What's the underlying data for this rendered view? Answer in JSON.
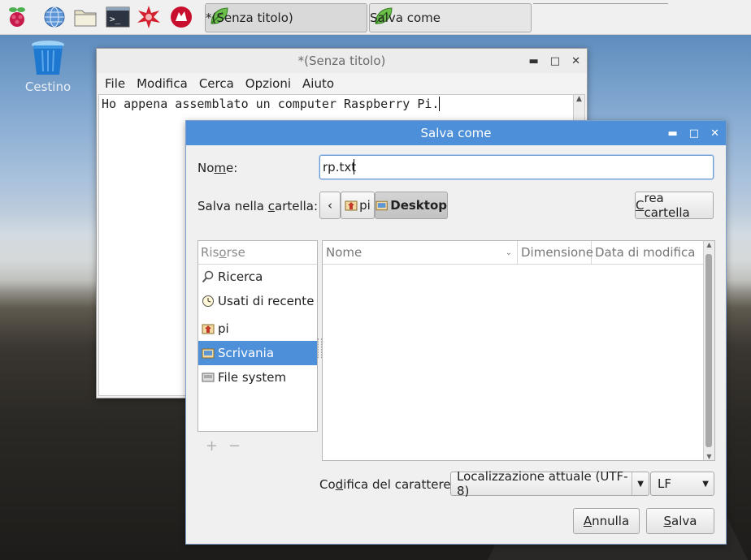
{
  "taskbar": {
    "tasks": [
      {
        "label": "*(Senza titolo)"
      },
      {
        "label": "Salva come"
      }
    ]
  },
  "desktop": {
    "trash_label": "Cestino"
  },
  "leafpad": {
    "title": "*(Senza titolo)",
    "menu": [
      "File",
      "Modifica",
      "Cerca",
      "Opzioni",
      "Aiuto"
    ],
    "text": "Ho appena assemblato un computer Raspberry Pi."
  },
  "save_dialog": {
    "title": "Salva come",
    "name_label_pre": "No",
    "name_label_u": "m",
    "name_label_post": "e:",
    "name_value": "rp.txt",
    "folder_label_pre": "Salva nella ",
    "folder_label_u": "c",
    "folder_label_post": "artella:",
    "path": [
      "pi",
      "Desktop"
    ],
    "create_folder_u": "C",
    "create_folder_rest": "rea cartella",
    "places_header_pre": "Ris",
    "places_header_u": "o",
    "places_header_post": "rse",
    "places": [
      "Ricerca",
      "Usati di recente",
      "pi",
      "Scrivania",
      "File system"
    ],
    "plus": "+",
    "minus": "−",
    "columns": [
      "Nome",
      "Dimensione",
      "Data di modifica"
    ],
    "encoding_label_pre": "Co",
    "encoding_label_u": "d",
    "encoding_label_post": "ifica del carattere:",
    "encoding_value": "Localizzazione attuale (UTF-8)",
    "lineend_value": "LF",
    "cancel_u": "A",
    "cancel_rest": "nnulla",
    "save_u": "S",
    "save_rest": "alva"
  },
  "colors": {
    "accent": "#4d8fd8"
  }
}
